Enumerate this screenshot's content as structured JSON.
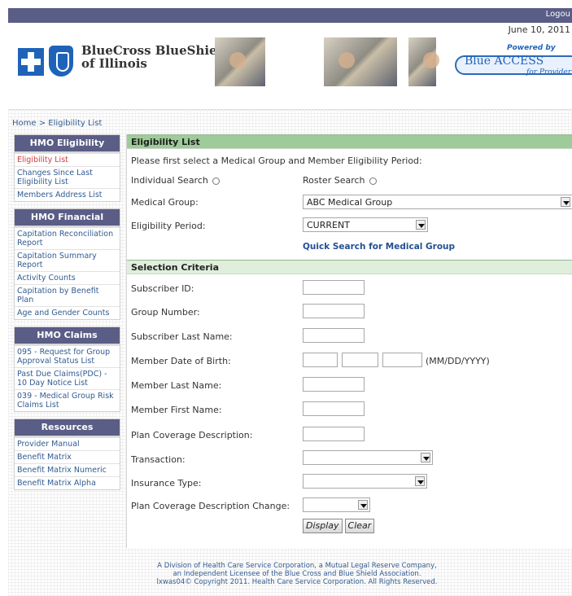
{
  "top": {
    "logout": "Logou",
    "date": "June 10, 2011"
  },
  "brand": {
    "line1": "BlueCross BlueShield",
    "line2": "of Illinois"
  },
  "blue_access": {
    "powered": "Powered by",
    "name": "Blue ACCESS",
    "tagline": "for Provider"
  },
  "breadcrumb": "Home > Eligibility List",
  "sidebar": [
    {
      "title": "HMO Eligibility",
      "items": [
        "Eligibility List",
        "Changes Since Last Eligibility List",
        "Members Address List"
      ],
      "active": 0
    },
    {
      "title": "HMO Financial",
      "items": [
        "Capitation Reconciliation Report",
        "Capitation Summary Report",
        "Activity Counts",
        "Capitation by Benefit Plan",
        "Age and Gender Counts"
      ]
    },
    {
      "title": "HMO Claims",
      "items": [
        "095 - Request for Group Approval Status List",
        "Past Due Claims(PDC) - 10 Day Notice List",
        "039 - Medical Group Risk Claims List"
      ]
    },
    {
      "title": "Resources",
      "items": [
        "Provider Manual",
        "Benefit Matrix",
        "Benefit Matrix Numeric",
        "Benefit Matrix Alpha"
      ]
    }
  ],
  "main": {
    "section1": "Eligibility List",
    "instruction": "Please first select a Medical Group and Member Eligibility Period:",
    "individual": "Individual Search",
    "roster": "Roster Search",
    "medical_group_label": "Medical Group:",
    "medical_group_value": "ABC Medical Group",
    "eligibility_label": "Eligibility Period:",
    "eligibility_value": "CURRENT",
    "quick_search": "Quick Search for Medical Group",
    "section2": "Selection Criteria",
    "fields": [
      "Subscriber ID:",
      "Group Number:",
      "Subscriber Last Name:",
      "Member Date of Birth:",
      "Member Last Name:",
      "Member First Name:",
      "Plan Coverage Description:",
      "Transaction:",
      "Insurance Type:",
      "Plan Coverage Description Change:"
    ],
    "dob_format": "(MM/DD/YYYY)",
    "display": "Display",
    "clear": "Clear"
  },
  "footer": {
    "line1": "A Division of Health Care Service Corporation, a Mutual Legal Reserve Company,",
    "line2": "an Independent Licensee of the Blue Cross and Blue Shield Association.",
    "line3": "lxwas04© Copyright 2011. Health Care Service Corporation. All Rights Reserved."
  }
}
